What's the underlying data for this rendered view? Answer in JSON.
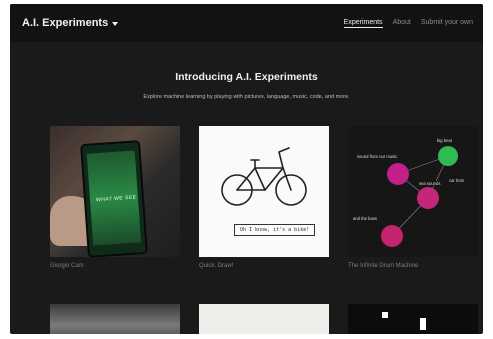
{
  "header": {
    "brand": "A.I. Experiments",
    "nav": [
      {
        "label": "Experiments",
        "active": true
      },
      {
        "label": "About",
        "active": false
      },
      {
        "label": "Submit your own",
        "active": false
      }
    ]
  },
  "hero": {
    "title": "Introducing A.I. Experiments",
    "subtitle": "Explore machine learning by playing with pictures, language, music, code, and more."
  },
  "cards": [
    {
      "title": "Giorgio Cam",
      "screen_text": "WHAT WE SEE"
    },
    {
      "title": "Quick, Draw!",
      "guess_text": "Oh I know, it's a bike!"
    },
    {
      "title": "The Infinite Drum Machine",
      "labels": [
        "sound from our music",
        "big beat",
        "sea sounds",
        "and the bass",
        "car horn"
      ]
    }
  ],
  "accent": "#ff3399"
}
